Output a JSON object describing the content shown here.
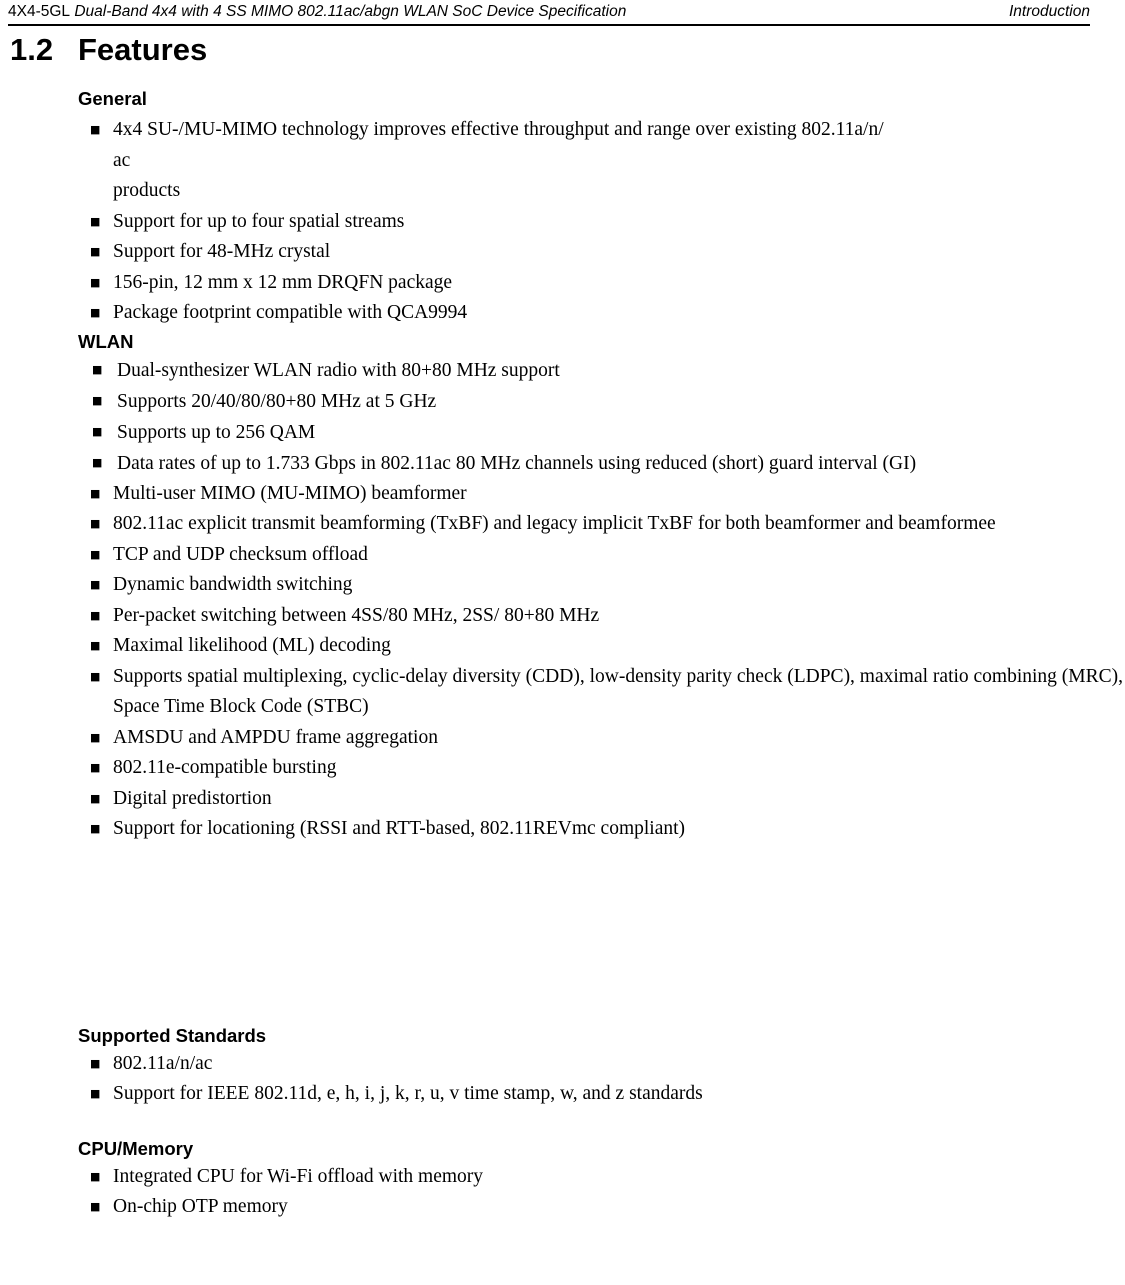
{
  "header": {
    "doc_code": "4X4-5GL",
    "doc_title": "Dual-Band 4x4 with 4 SS MIMO 802.11ac/abgn WLAN SoC Device Specification",
    "chapter_label": "Introduction"
  },
  "chapter": {
    "number": "1.2",
    "title": "Features"
  },
  "sections": [
    {
      "heading": "General",
      "bullets": [
        {
          "text": "4x4 SU-/MU-MIMO technology improves effective throughput and range over existing 802.11a/n/",
          "continuations": [
            "ac",
            "products"
          ]
        },
        {
          "text": "Support for up to four spatial streams"
        },
        {
          "text": "Support for 48-MHz crystal"
        },
        {
          "text": "156-pin, 12 mm x 12 mm DRQFN package"
        },
        {
          "text": "Package footprint compatible with QCA9994"
        }
      ]
    },
    {
      "heading": "WLAN",
      "bullets_upper": [
        {
          "text": "Dual-synthesizer WLAN radio with 80+80 MHz support"
        },
        {
          "text": "Supports 20/40/80/80+80 MHz at 5 GHz"
        },
        {
          "text": "Supports up to 256 QAM"
        },
        {
          "text": "Data rates of up to 1.733 Gbps in 802.11ac 80 MHz channels using reduced (short) guard interval (GI)"
        }
      ],
      "bullets_lower": [
        {
          "text": "Multi-user MIMO (MU-MIMO) beamformer"
        },
        {
          "text": "802.11ac explicit transmit beamforming (TxBF) and legacy implicit TxBF for both beamformer and beamformee"
        },
        {
          "text": "TCP and UDP checksum offload"
        },
        {
          "text": "Dynamic bandwidth switching"
        },
        {
          "text": "Per-packet switching between 4SS/80 MHz, 2SS/ 80+80 MHz"
        },
        {
          "text": "Maximal likelihood (ML) decoding"
        },
        {
          "text": "Supports spatial multiplexing, cyclic-delay diversity (CDD), low-density parity check (LDPC), maximal ratio combining (MRC), Space Time Block Code (STBC)"
        },
        {
          "text": "AMSDU and AMPDU frame aggregation"
        },
        {
          "text": "802.11e-compatible bursting"
        },
        {
          "text": "Digital predistortion"
        },
        {
          "text": "Support for locationing (RSSI and RTT-based, 802.11REVmc compliant)"
        }
      ]
    },
    {
      "heading": "Supported Standards",
      "bullets": [
        {
          "text": "802.11a/n/ac"
        },
        {
          "text": "Support for IEEE 802.11d, e, h, i, j, k, r, u, v time stamp, w, and z standards"
        }
      ]
    },
    {
      "heading": "CPU/Memory",
      "bullets": [
        {
          "text": "Integrated CPU for Wi-Fi offload with memory"
        },
        {
          "text": "On-chip OTP memory"
        }
      ]
    }
  ],
  "glyphs": {
    "bullet_square": "■"
  }
}
